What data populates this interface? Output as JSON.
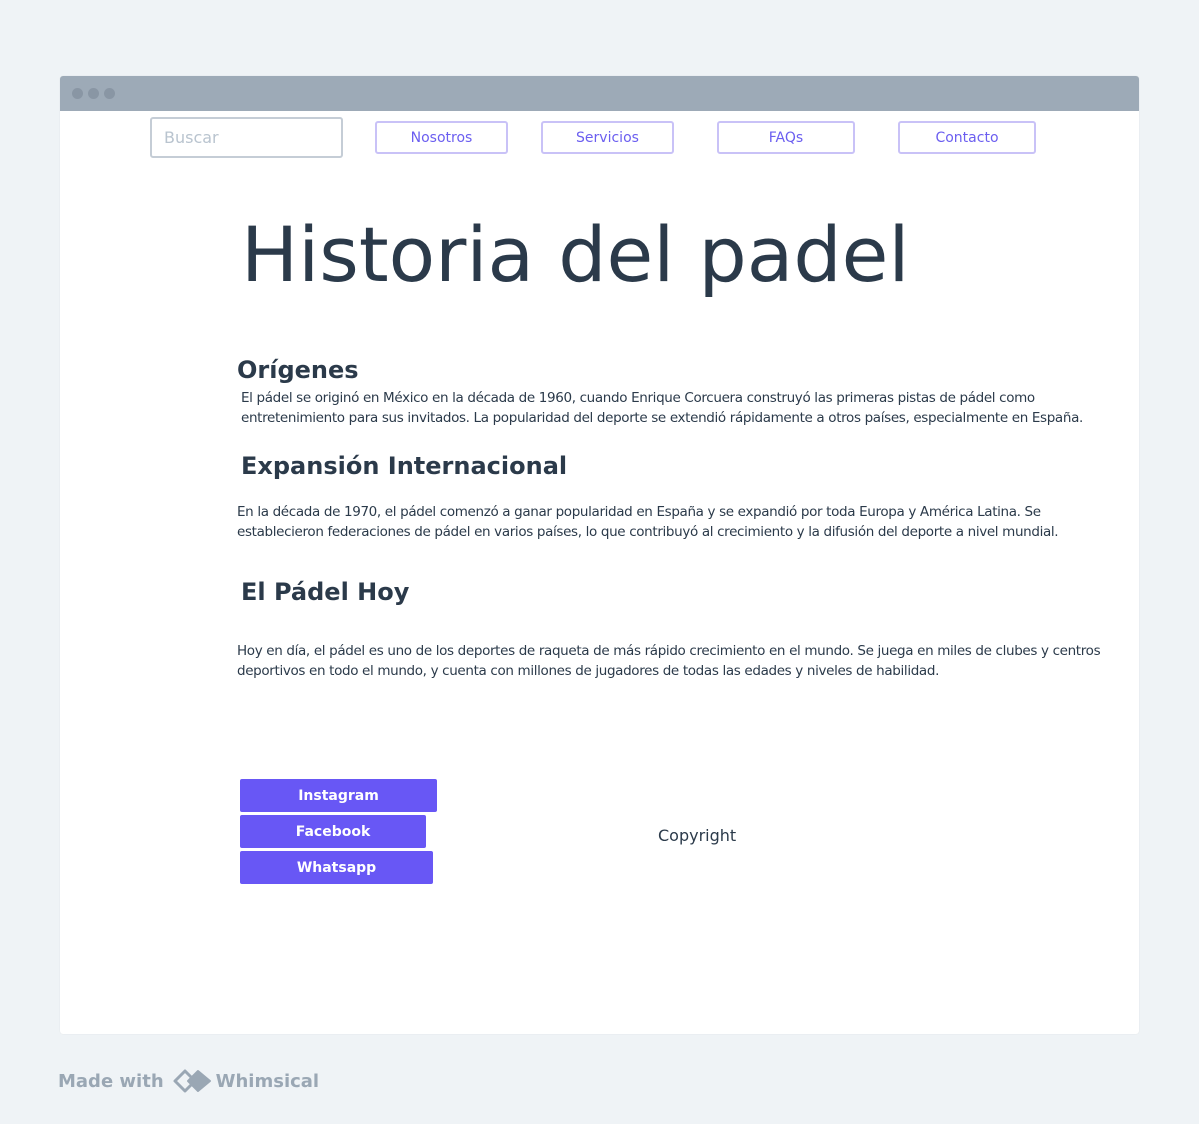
{
  "search": {
    "placeholder": "Buscar"
  },
  "nav": {
    "items": [
      {
        "label": "Nosotros"
      },
      {
        "label": "Servicios"
      },
      {
        "label": "FAQs"
      },
      {
        "label": "Contacto"
      }
    ]
  },
  "main": {
    "title": "Historia del padel",
    "sections": [
      {
        "heading": "Orígenes",
        "text": "El pádel se originó en México en la década de 1960, cuando Enrique Corcuera construyó las primeras pistas de pádel como entretenimiento para sus invitados. La popularidad del deporte se extendió rápidamente a otros países, especialmente en España."
      },
      {
        "heading": "Expansión Internacional",
        "text": "En la década de 1970, el pádel comenzó a ganar popularidad en España y se expandió por toda Europa y América Latina. Se establecieron federaciones de pádel en varios países, lo que contribuyó al crecimiento y la difusión del deporte a nivel mundial."
      },
      {
        "heading": "El Pádel Hoy",
        "text": "Hoy en día, el pádel es uno de los deportes de raqueta de más rápido crecimiento en el mundo. Se juega en miles de clubes y centros deportivos en todo el mundo, y cuenta con millones de jugadores de todas las edades y niveles de habilidad."
      }
    ]
  },
  "footer": {
    "social": [
      {
        "label": "Instagram"
      },
      {
        "label": "Facebook"
      },
      {
        "label": "Whatsapp"
      }
    ],
    "copyright": "Copyright"
  },
  "watermark": {
    "prefix": "Made with",
    "brand": "Whimsical"
  },
  "colors": {
    "background": "#eff3f6",
    "titlebar": "#9daab7",
    "accent": "#6857f5",
    "nav_text": "#6b5ef0",
    "nav_border": "#c9c2f7",
    "heading_text": "#2b3a4a"
  },
  "icons": {
    "window_controls": "window-dots-icon",
    "brand_logo": "whimsical-logo-icon"
  }
}
